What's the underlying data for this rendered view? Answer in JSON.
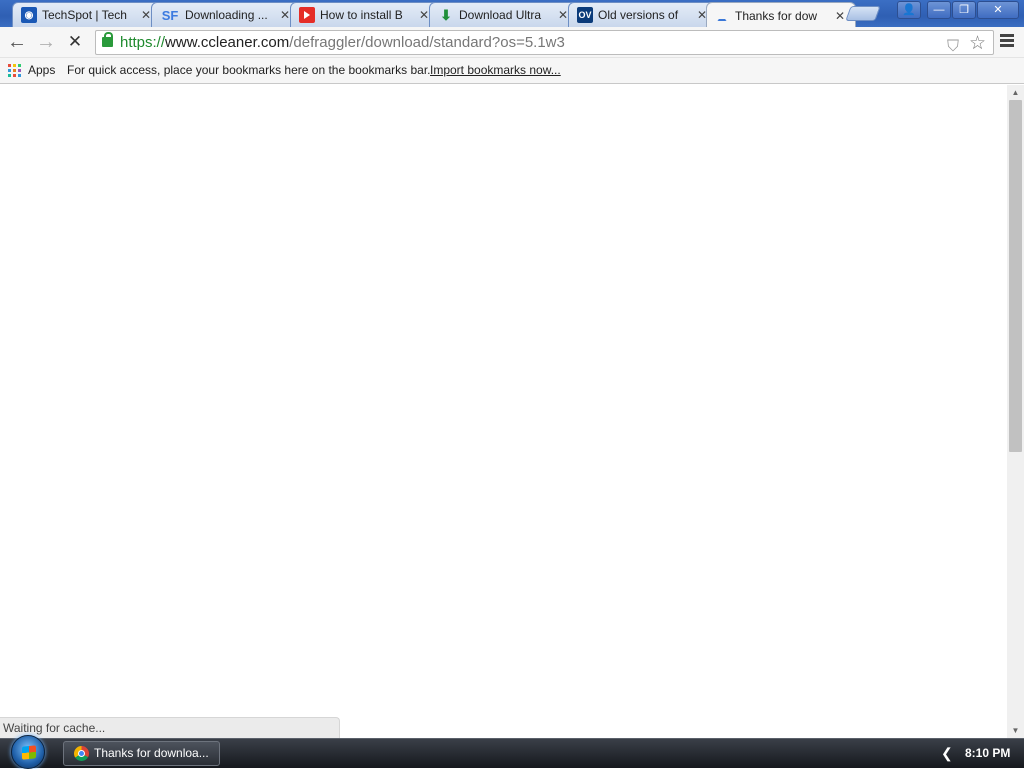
{
  "browser": {
    "tabs": [
      {
        "label": "TechSpot | Tech",
        "favicon": "techspot-icon",
        "favicon_text": ""
      },
      {
        "label": "Downloading ...",
        "favicon": "sourceforge-icon",
        "favicon_text": "SF"
      },
      {
        "label": "How to install B",
        "favicon": "youtube-icon",
        "favicon_text": ""
      },
      {
        "label": "Download Ultra",
        "favicon": "download-arrow-icon",
        "favicon_text": "⬇"
      },
      {
        "label": "Old versions of",
        "favicon": "oldversion-icon",
        "favicon_text": "OV"
      },
      {
        "label": "Thanks for dow",
        "favicon": "loading-spinner-icon",
        "favicon_text": "",
        "active": true
      }
    ],
    "tab_close_glyph": "✕",
    "window_controls": {
      "user": "👤",
      "minimize": "—",
      "restore": "❐",
      "close": "✕"
    }
  },
  "toolbar": {
    "back": "←",
    "forward": "→",
    "stop": "✕",
    "url_scheme": "https://",
    "url_host": "www.ccleaner.com",
    "url_path": "/defraggler/download/standard?os=5.1w3",
    "shield": "⛉",
    "star": "☆"
  },
  "bookmarks_bar": {
    "apps_label": "Apps",
    "hint": "For quick access, place your bookmarks here on the bookmarks bar.",
    "import_link": "Import bookmarks now..."
  },
  "scrollbar": {
    "up": "▲",
    "down": "▼"
  },
  "status": {
    "text": "Waiting for cache..."
  },
  "taskbar": {
    "task_label": "Thanks for downloa...",
    "tray_arrow": "❮",
    "clock": "8:10 PM"
  },
  "colors": {
    "titlebar": "#3b6fc4",
    "url_scheme": "#1f8a2e",
    "lock": "#2a9a3b"
  }
}
